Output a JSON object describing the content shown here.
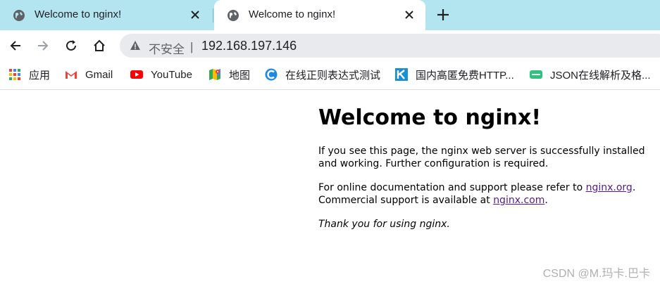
{
  "tabs": [
    {
      "title": "Welcome to nginx!",
      "state": "inactive",
      "icon": "globe-icon"
    },
    {
      "title": "Welcome to nginx!",
      "state": "active",
      "icon": "globe-icon"
    }
  ],
  "address_bar": {
    "security_label": "不安全",
    "divider": "|",
    "url": "192.168.197.146"
  },
  "bookmarks": [
    {
      "label": "应用",
      "icon": "apps-grid-icon"
    },
    {
      "label": "Gmail",
      "icon": "gmail-icon"
    },
    {
      "label": "YouTube",
      "icon": "youtube-icon"
    },
    {
      "label": "地图",
      "icon": "maps-icon"
    },
    {
      "label": "在线正则表达式测试",
      "icon": "regex-site-icon"
    },
    {
      "label": "国内高匿免费HTTP...",
      "icon": "k-site-icon"
    },
    {
      "label": "JSON在线解析及格...",
      "icon": "json-icon"
    }
  ],
  "page": {
    "heading": "Welcome to nginx!",
    "para1": "If you see this page, the nginx web server is successfully installed and working. Further configuration is required.",
    "para2_prefix": "For online documentation and support please refer to ",
    "link1": "nginx.org",
    "para2_mid": ". Commercial support is available at ",
    "link2": "nginx.com",
    "para2_suffix": ".",
    "para3": "Thank you for using nginx."
  },
  "watermark": "CSDN @M.玛卡.巴卡",
  "colors": {
    "tabstrip_bg": "#b3e5f1",
    "link": "#551a8b",
    "youtube_red": "#ff0000",
    "json_green": "#2ec27e"
  }
}
